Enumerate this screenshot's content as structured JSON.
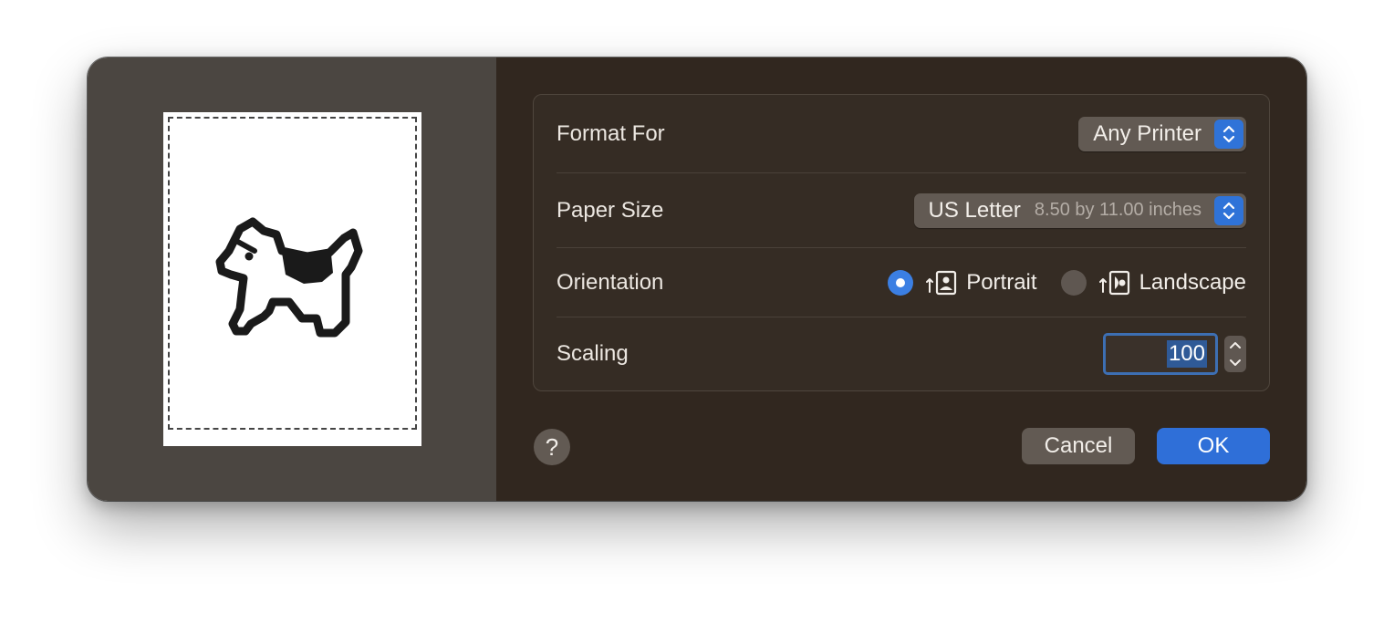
{
  "dialog": {
    "format_for": {
      "label": "Format For",
      "value": "Any Printer"
    },
    "paper_size": {
      "label": "Paper Size",
      "value": "US Letter",
      "detail": "8.50 by 11.00 inches"
    },
    "orientation": {
      "label": "Orientation",
      "options": [
        {
          "label": "Portrait",
          "selected": true,
          "icon": "portrait-orientation-icon"
        },
        {
          "label": "Landscape",
          "selected": false,
          "icon": "landscape-orientation-icon"
        }
      ]
    },
    "scaling": {
      "label": "Scaling",
      "value": "100"
    },
    "help_label": "?",
    "cancel_label": "Cancel",
    "ok_label": "OK"
  },
  "preview": {
    "icon": "dogcow-icon"
  },
  "colors": {
    "accent": "#2f6fd8",
    "preview_bg": "#4b4641",
    "settings_bg": "#31271f"
  }
}
